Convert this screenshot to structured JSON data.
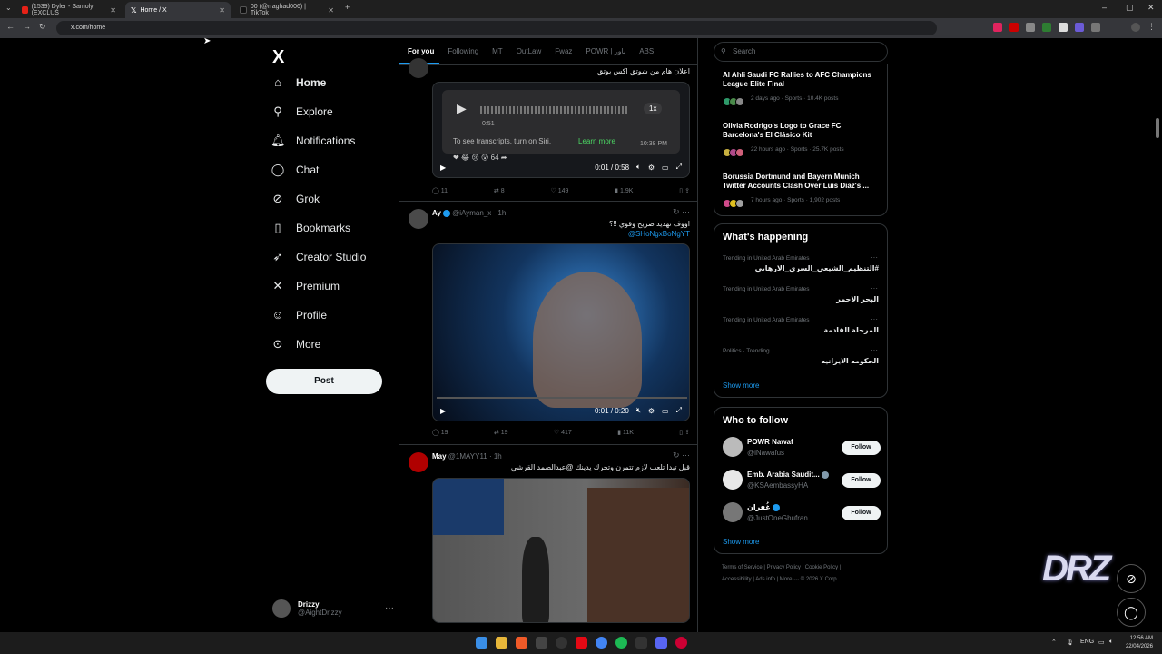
{
  "browser": {
    "tabs": [
      {
        "label": "(1539) Dyler - Samoly (EXCLUS",
        "active": false
      },
      {
        "label": "Home / X",
        "active": true
      },
      {
        "label": "00 (@rraghad006) | TikTok",
        "active": false
      }
    ],
    "url": "x.com/home"
  },
  "sidebar": {
    "logo": "X",
    "items": [
      {
        "label": "Home",
        "icon": "home-icon"
      },
      {
        "label": "Explore",
        "icon": "search-icon"
      },
      {
        "label": "Notifications",
        "icon": "bell-icon"
      },
      {
        "label": "Chat",
        "icon": "chat-icon"
      },
      {
        "label": "Grok",
        "icon": "grok-icon"
      },
      {
        "label": "Bookmarks",
        "icon": "bookmark-icon"
      },
      {
        "label": "Creator Studio",
        "icon": "rocket-icon"
      },
      {
        "label": "Premium",
        "icon": "x-premium-icon"
      },
      {
        "label": "Profile",
        "icon": "person-icon"
      },
      {
        "label": "More",
        "icon": "more-circle-icon"
      }
    ],
    "post_label": "Post",
    "account": {
      "name": "Drizzy",
      "handle": "@AightDrizzy"
    }
  },
  "feed": {
    "tabs": [
      "For you",
      "Following",
      "MT",
      "OutLaw",
      "Fwaz",
      "POWR | باور",
      "ABS"
    ],
    "tweet1": {
      "text": "اعلان هام من شوتق اكس بوتق",
      "audio_time": "0:51",
      "speed": "1x",
      "siri_note": "To see transcripts, turn on Siri.",
      "learn_more": "Learn more",
      "timestamp": "10:38 PM",
      "reaction_count": "64",
      "player_time": "0:01 / 0:58",
      "stats": {
        "replies": "11",
        "reposts": "8",
        "likes": "149",
        "views": "1.9K"
      }
    },
    "tweet2": {
      "name": "Ay",
      "handle": "@iAyman_x · 1h",
      "text": "اووف تهديد صريح وقوي !!؟",
      "mention": "@SHoNgxBoNgYT",
      "player_time": "0:01 / 0:20",
      "stats": {
        "replies": "19",
        "reposts": "19",
        "likes": "417",
        "views": "11K"
      }
    },
    "tweet3": {
      "name": "May",
      "handle": "@1MAYY11 · 1h",
      "text": "قبل تبدا تلعب لازم تتمرن وتحرك يدينك @عبدالصمد القرشي"
    }
  },
  "right": {
    "search_placeholder": "Search",
    "news": [
      {
        "title": "Al Ahli Saudi FC Rallies to AFC Champions League Elite Final",
        "meta": "2 days ago · Sports · 10.4K posts"
      },
      {
        "title": "Olivia Rodrigo's Logo to Grace FC Barcelona's El Clásico Kit",
        "meta": "22 hours ago · Sports · 25.7K posts"
      },
      {
        "title": "Borussia Dortmund and Bayern Munich Twitter Accounts Clash Over Luis Diaz's ...",
        "meta": "7 hours ago · Sports · 1,902 posts"
      }
    ],
    "happening_title": "What's happening",
    "trends": [
      {
        "context": "Trending in United Arab Emirates",
        "text": "#التنظيم_الشيعي_السري_الارهابي"
      },
      {
        "context": "Trending in United Arab Emirates",
        "text": "البحر الاحمر"
      },
      {
        "context": "Trending in United Arab Emirates",
        "text": "المرحلة القادمة"
      },
      {
        "context": "Politics · Trending",
        "text": "الحكومه الايرانيه"
      }
    ],
    "show_more": "Show more",
    "wtf_title": "Who to follow",
    "follow": [
      {
        "name": "POWR Nawaf",
        "handle": "@iNawafus"
      },
      {
        "name": "Emb. Arabia Saudit...",
        "handle": "@KSAembassyHA"
      },
      {
        "name": "غُفران",
        "handle": "@JustOneGhufran"
      }
    ],
    "follow_label": "Follow",
    "footer1": "Terms of Service  |  Privacy Policy  |  Cookie Policy  |",
    "footer2": "Accessibility  |  Ads info  |  More ···  © 2026 X Corp."
  },
  "taskbar": {
    "lang": "ENG",
    "time": "12:56 AM",
    "date": "22/04/2026"
  },
  "overlay": {
    "logo_text": "DRZ"
  }
}
